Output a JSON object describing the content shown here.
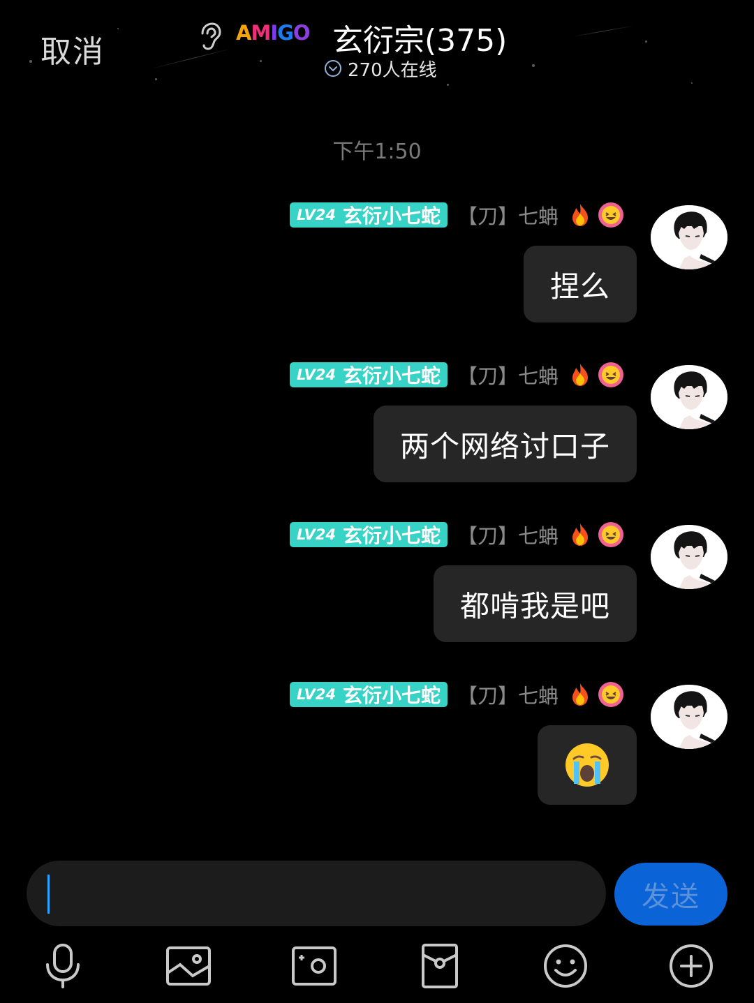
{
  "header": {
    "cancel_label": "取消",
    "logo_letters": [
      "A",
      "M",
      "I",
      "G",
      "O"
    ],
    "logo_colors": [
      "#f3a40b",
      "#ef2f78",
      "#7b3cf0",
      "#1b7cf2",
      "#8b3fe0"
    ],
    "title": "玄衍宗(375)",
    "online_text": "270人在线"
  },
  "timestamp": "下午1:50",
  "messages": [
    {
      "level": "LV24",
      "nickname": "玄衍小七蛇",
      "sender": "【刀】七蚺",
      "text": "捏么"
    },
    {
      "level": "LV24",
      "nickname": "玄衍小七蛇",
      "sender": "【刀】七蚺",
      "text": "两个网络讨口子"
    },
    {
      "level": "LV24",
      "nickname": "玄衍小七蛇",
      "sender": "【刀】七蚺",
      "text": "都啃我是吧"
    },
    {
      "level": "LV24",
      "nickname": "玄衍小七蛇",
      "sender": "【刀】七蚺",
      "text": "😭"
    }
  ],
  "composer": {
    "input_value": "",
    "send_label": "发送"
  },
  "toolbar": {
    "icons": [
      "microphone-icon",
      "photo-icon",
      "camera-icon",
      "red-packet-icon",
      "emoji-icon",
      "add-icon"
    ]
  },
  "colors": {
    "background": "#000000",
    "badge": "#37d3c6",
    "bubble": "#262626",
    "send_button": "#0a64d8",
    "caret": "#2aa4ff"
  }
}
